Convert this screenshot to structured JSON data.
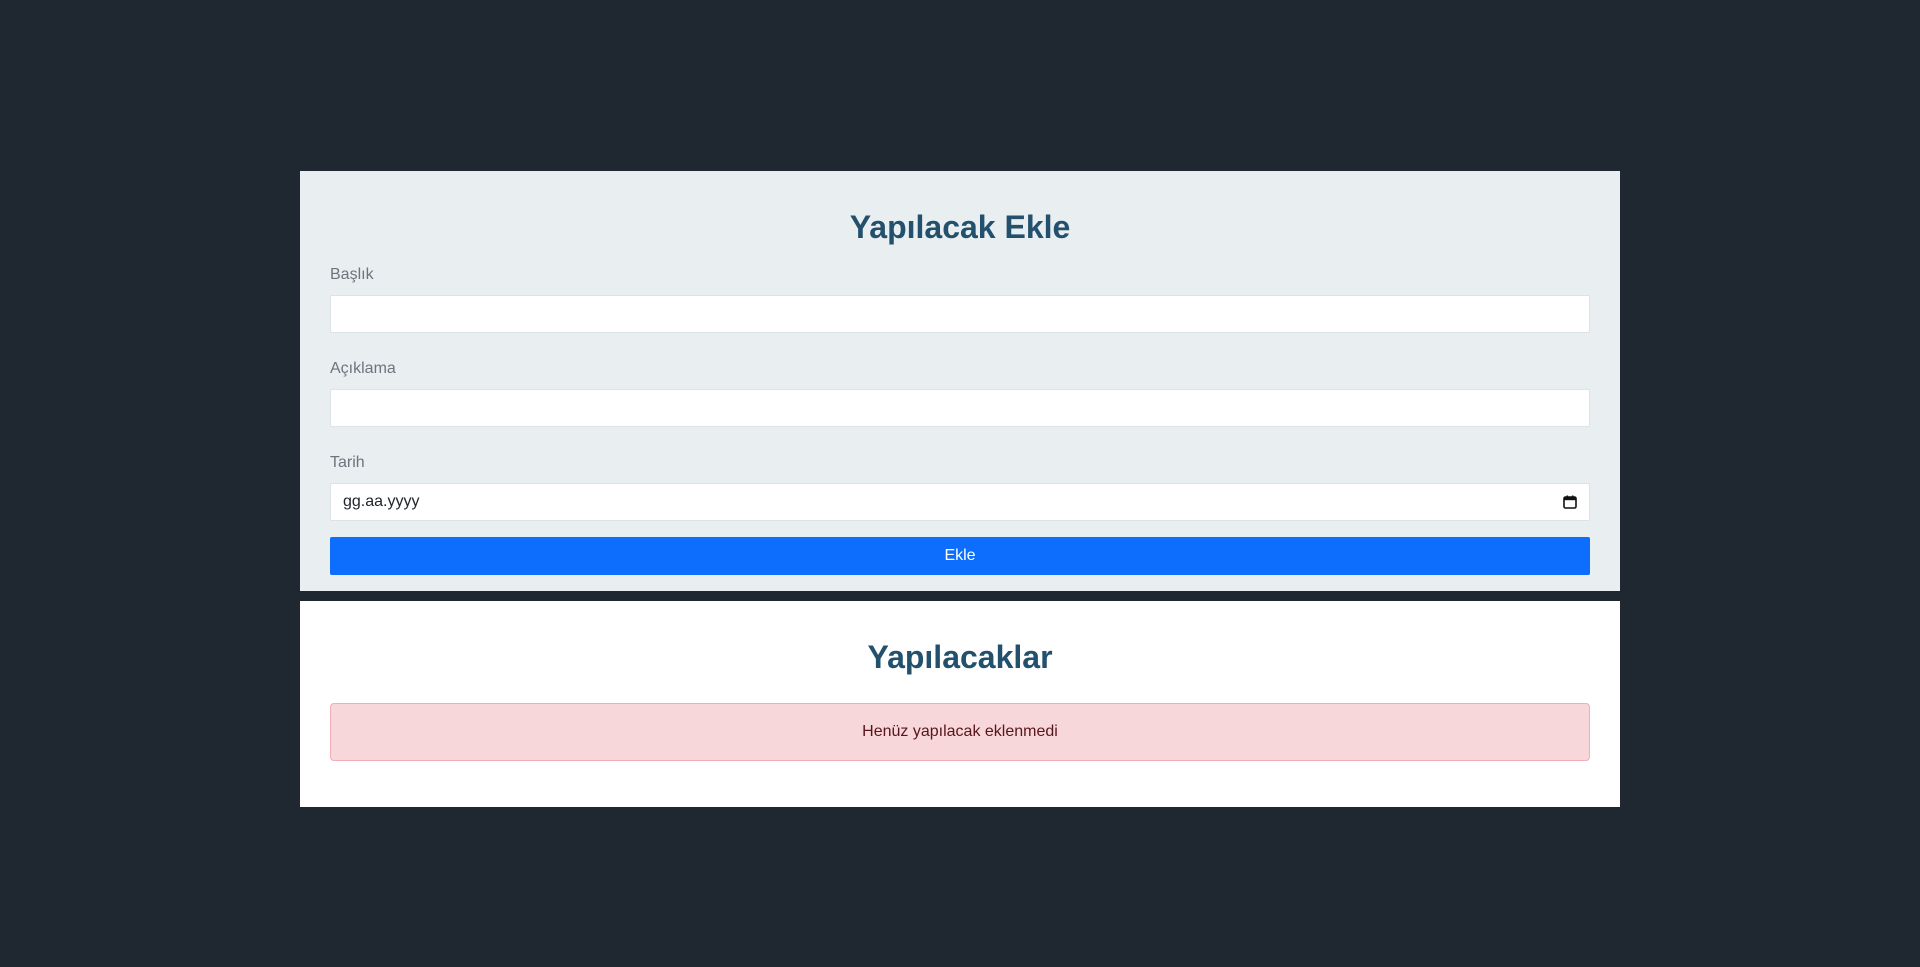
{
  "add_form": {
    "title": "Yapılacak Ekle",
    "fields": [
      {
        "label": "Başlık",
        "value": "",
        "placeholder": ""
      },
      {
        "label": "Açıklama",
        "value": "",
        "placeholder": ""
      },
      {
        "label": "Tarih",
        "value": "",
        "placeholder": "gg.aa.yyyy"
      }
    ],
    "submit_label": "Ekle"
  },
  "todo_list": {
    "title": "Yapılacaklar",
    "empty_message": "Henüz yapılacak eklenmedi"
  },
  "icons": {
    "date_picker": "calendar-icon"
  },
  "colors": {
    "page_background": "#1f2831",
    "form_card_background": "#e9eef0",
    "list_card_background": "#ffffff",
    "title_color": "#22506d",
    "primary_button": "#0d6efd",
    "alert_background": "#f8d7da",
    "alert_text": "#58151c"
  }
}
